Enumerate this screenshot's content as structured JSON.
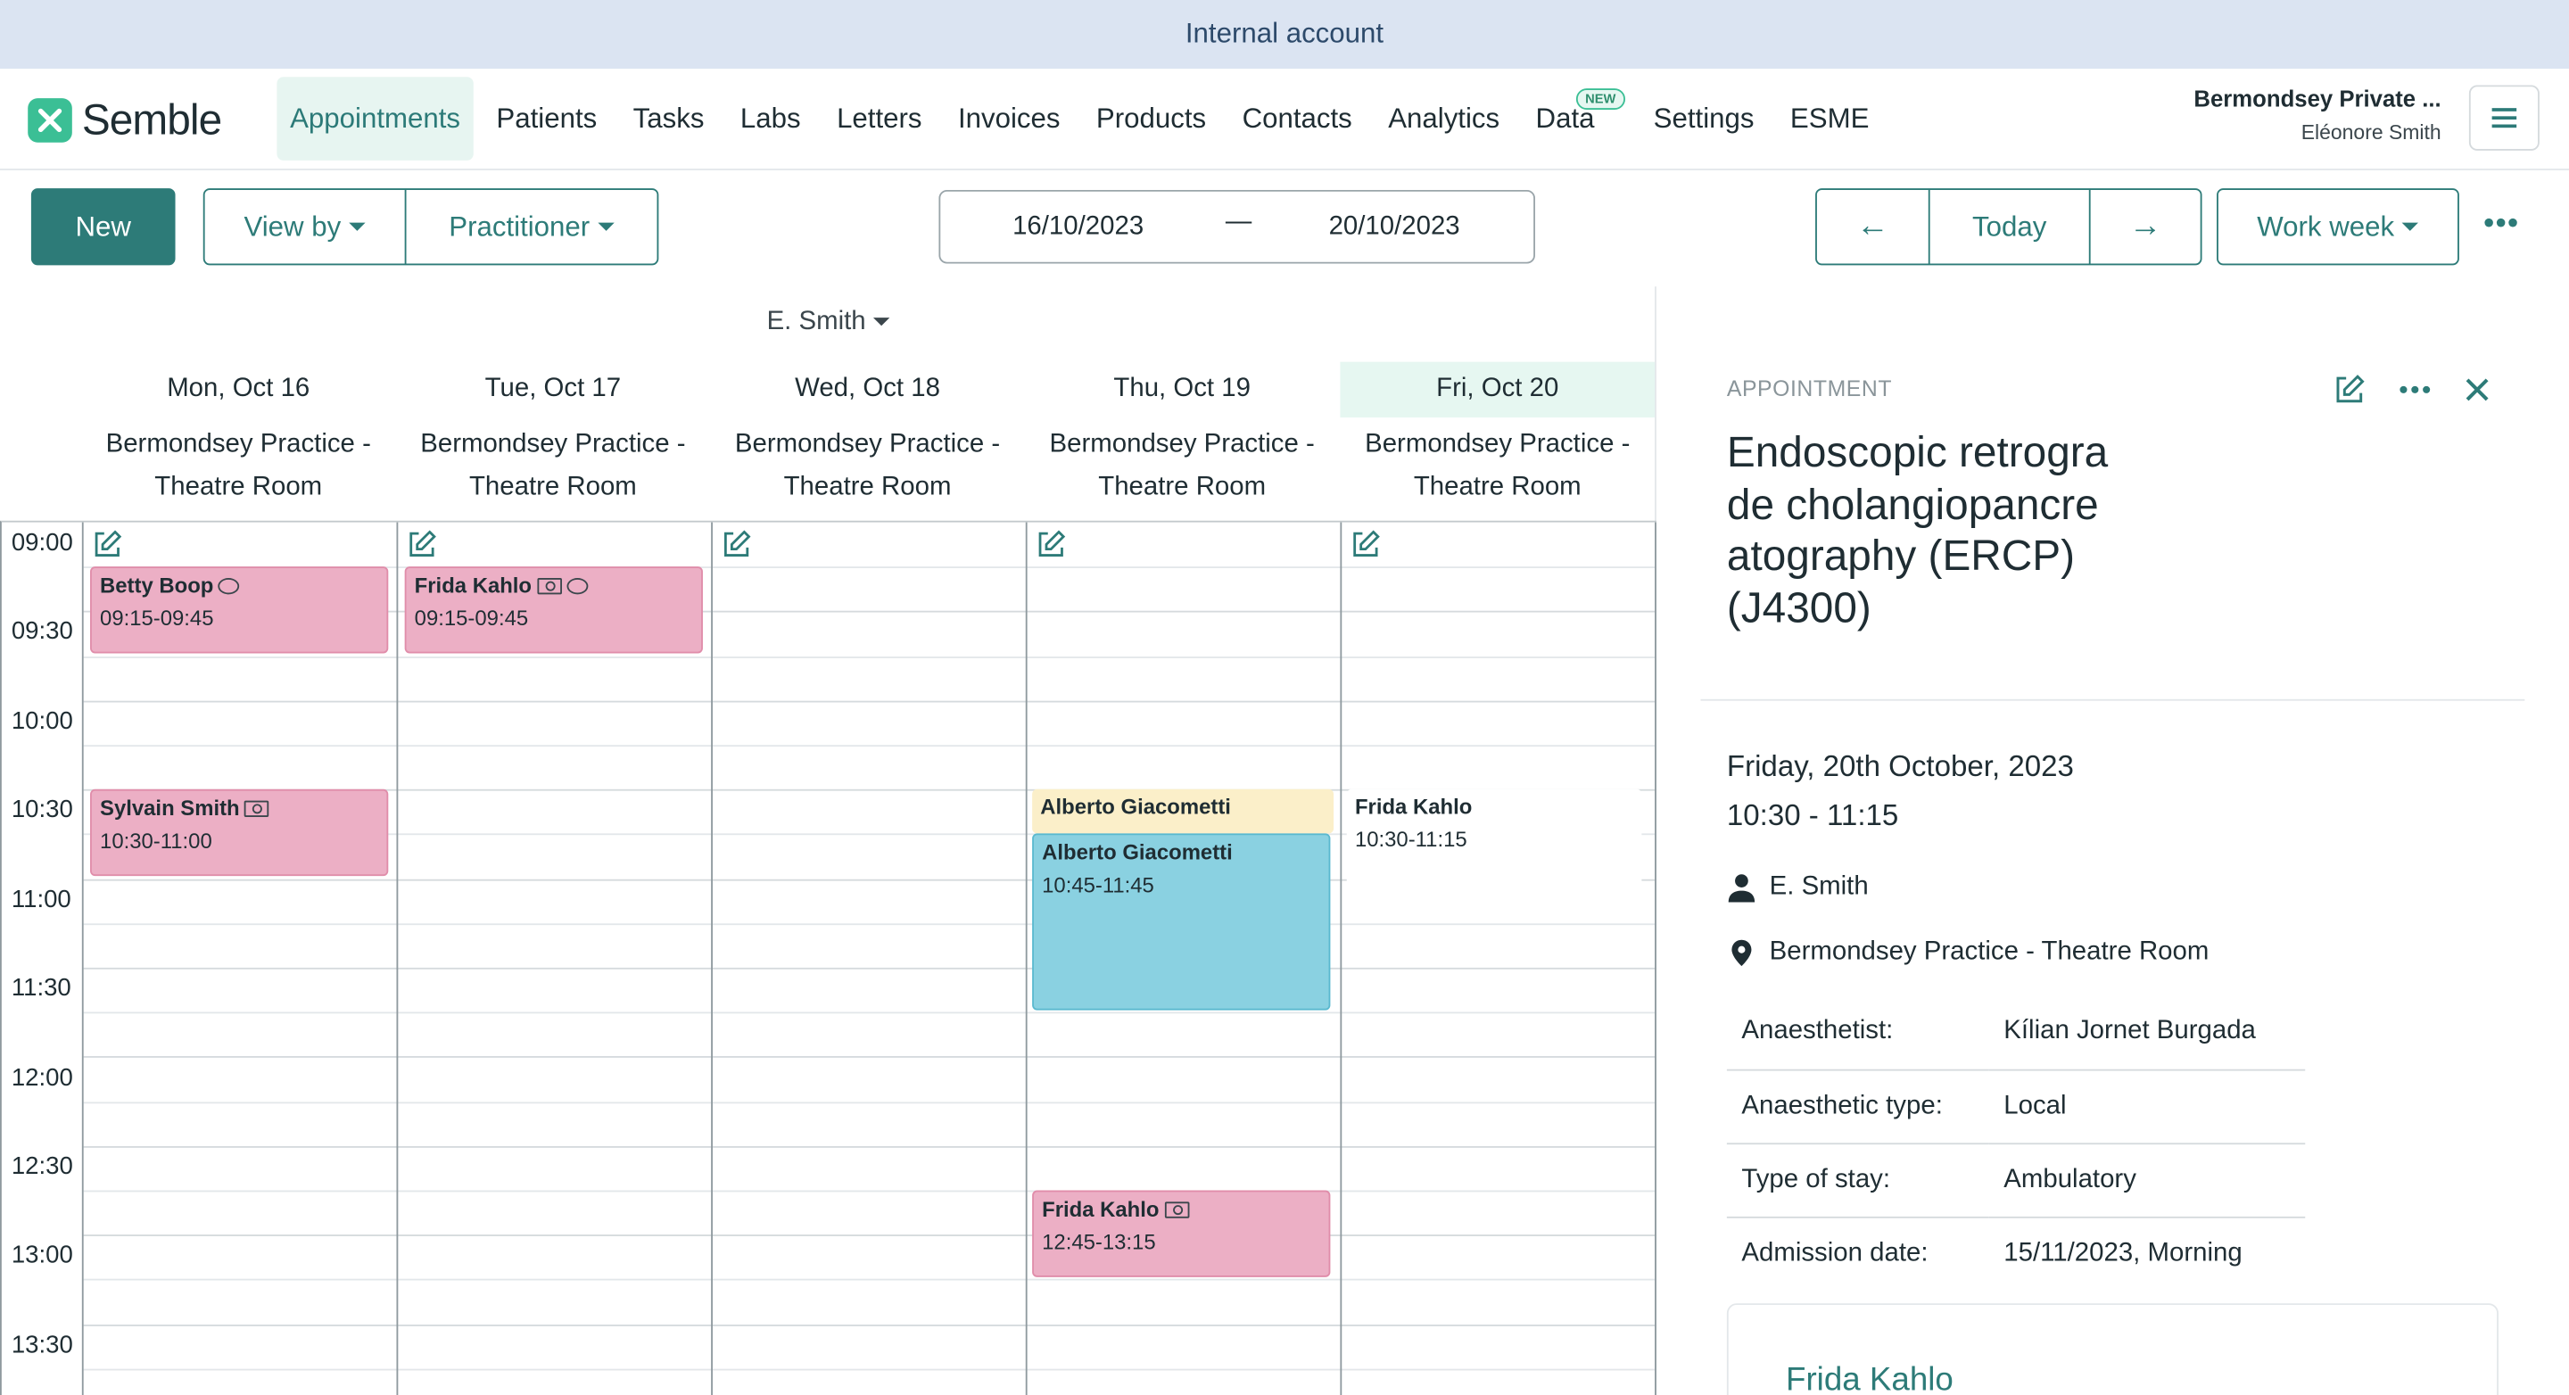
{
  "banner": {
    "text": "Internal account"
  },
  "brand": {
    "name": "Semble",
    "accent": "#2d7b78",
    "logo_color": "#3bbf95"
  },
  "nav": {
    "items": [
      {
        "label": "Appointments",
        "active": true
      },
      {
        "label": "Patients"
      },
      {
        "label": "Tasks"
      },
      {
        "label": "Labs"
      },
      {
        "label": "Letters"
      },
      {
        "label": "Invoices"
      },
      {
        "label": "Products"
      },
      {
        "label": "Contacts"
      },
      {
        "label": "Analytics"
      },
      {
        "label": "Data",
        "badge": "NEW"
      },
      {
        "label": "Settings"
      },
      {
        "label": "ESME"
      }
    ],
    "org_name": "Bermondsey Private ...",
    "user_name": "Eléonore Smith",
    "menu_icon": "hamburger-icon"
  },
  "toolbar": {
    "new_label": "New",
    "view_by_label": "View by",
    "practitioner_label": "Practitioner",
    "date_from": "16/10/2023",
    "date_sep": "—",
    "date_to": "20/10/2023",
    "prev_icon": "←",
    "today_label": "Today",
    "next_icon": "→",
    "range_label": "Work week",
    "more_icon": "•••"
  },
  "calendar": {
    "practitioner": "E. Smith",
    "days": [
      {
        "label": "Mon, Oct 16",
        "resource_line1": "Bermondsey Practice -",
        "resource_line2": "Theatre Room"
      },
      {
        "label": "Tue, Oct 17",
        "resource_line1": "Bermondsey Practice -",
        "resource_line2": "Theatre Room"
      },
      {
        "label": "Wed, Oct 18",
        "resource_line1": "Bermondsey Practice -",
        "resource_line2": "Theatre Room"
      },
      {
        "label": "Thu, Oct 19",
        "resource_line1": "Bermondsey Practice -",
        "resource_line2": "Theatre Room"
      },
      {
        "label": "Fri, Oct 20",
        "resource_line1": "Bermondsey Practice -",
        "resource_line2": "Theatre Room",
        "today": true
      }
    ],
    "times": [
      "09:00",
      "09:30",
      "10:00",
      "10:30",
      "11:00",
      "11:30",
      "12:00",
      "12:30",
      "13:00",
      "13:30"
    ],
    "appointments": [
      {
        "day": 0,
        "name": "Betty Boop",
        "time": "09:15-09:45",
        "color": "pink",
        "icons": [
          "comment-icon"
        ]
      },
      {
        "day": 1,
        "name": "Frida Kahlo",
        "time": "09:15-09:45",
        "color": "pink",
        "icons": [
          "cash-icon",
          "comment-icon"
        ]
      },
      {
        "day": 0,
        "name": "Sylvain Smith",
        "time": "10:30-11:00",
        "color": "pink",
        "icons": [
          "cash-icon"
        ]
      },
      {
        "day": 3,
        "name": "Alberto Giacometti",
        "time": "",
        "color": "yellow",
        "icons": []
      },
      {
        "day": 3,
        "name": "Alberto Giacometti",
        "time": "10:45-11:45",
        "color": "blue",
        "icons": []
      },
      {
        "day": 4,
        "name": "Frida Kahlo",
        "time": "10:30-11:15",
        "color": "plain",
        "icons": []
      },
      {
        "day": 3,
        "name": "Frida Kahlo",
        "time": "12:45-13:15",
        "color": "pink",
        "icons": [
          "cash-icon"
        ]
      }
    ]
  },
  "panel": {
    "label": "APPOINTMENT",
    "title": "Endoscopic retrograde cholangiopancreatography (ERCP) (J4300)",
    "date": "Friday, 20th October, 2023",
    "time": "10:30 - 11:15",
    "practitioner": "E. Smith",
    "location": "Bermondsey Practice - Theatre Room",
    "details": [
      {
        "key": "Anaesthetist:",
        "value": "Kílian Jornet Burgada"
      },
      {
        "key": "Anaesthetic type:",
        "value": "Local"
      },
      {
        "key": "Type of stay:",
        "value": "Ambulatory"
      },
      {
        "key": "Admission date:",
        "value": "15/11/2023, Morning"
      }
    ],
    "patient_name": "Frida Kahlo"
  }
}
